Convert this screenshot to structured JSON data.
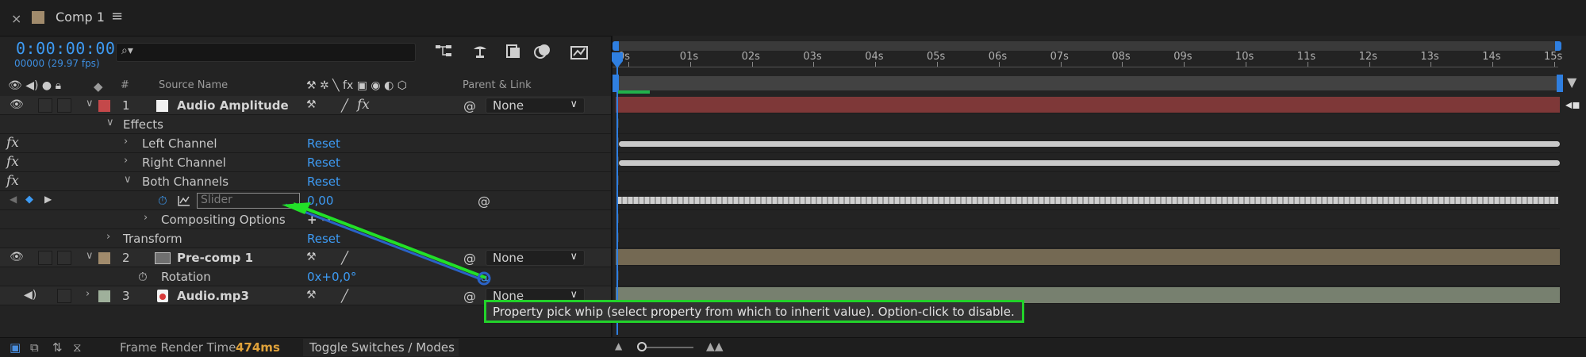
{
  "tab": {
    "close": "×",
    "title": "Comp 1",
    "menu": "≡",
    "swatch_color": "#a18b6c"
  },
  "header": {
    "timecode": "0:00:00:00",
    "fps_readout": "00000 (29.97 fps)",
    "search": {
      "icon": "search-icon",
      "value": ""
    },
    "icons": [
      "composition-flowchart-icon",
      "draft-3d-icon",
      "shy-layers-icon",
      "frame-blending-icon",
      "graph-editor-icon"
    ]
  },
  "columns": {
    "hash": "#",
    "source_name": "Source Name",
    "parent_link": "Parent & Link"
  },
  "layers": [
    {
      "index": "1",
      "name": "Audio Amplitude",
      "label_color": "#c4484a",
      "parent": "None"
    },
    {
      "index": "2",
      "name": "Pre-comp 1",
      "label_color": "#a18b6c",
      "parent": "None"
    },
    {
      "index": "3",
      "name": "Audio.mp3",
      "label_color": "#9fb09b",
      "parent": "None"
    }
  ],
  "effects": {
    "group_label": "Effects",
    "left_channel": "Left Channel",
    "right_channel": "Right Channel",
    "both_channels": "Both Channels",
    "reset": "Reset",
    "slider_placeholder": "Slider",
    "slider_value": "0,00",
    "compositing_options": "Compositing Options",
    "compositing_value": "+ −"
  },
  "transform": {
    "label": "Transform",
    "reset": "Reset"
  },
  "rotation": {
    "label": "Rotation",
    "value": "0x+0,0°"
  },
  "timeline": {
    "ticks": [
      "0s",
      "01s",
      "02s",
      "03s",
      "04s",
      "05s",
      "06s",
      "07s",
      "08s",
      "09s",
      "10s",
      "11s",
      "12s",
      "13s",
      "14s",
      "15s"
    ],
    "colors": {
      "layer1_bar": "#7e3838",
      "layer2_bar": "#746953",
      "layer3_bar": "#77806f",
      "playhead": "#2f7fe0"
    }
  },
  "bottom": {
    "frame_render_label": "Frame Render Time",
    "frame_render_value": "474ms",
    "toggle_label": "Toggle Switches / Modes"
  },
  "tooltip": {
    "text": "Property pick whip (select property from which to inherit value). Option-click to disable.",
    "highlight_color": "#22d22a"
  }
}
